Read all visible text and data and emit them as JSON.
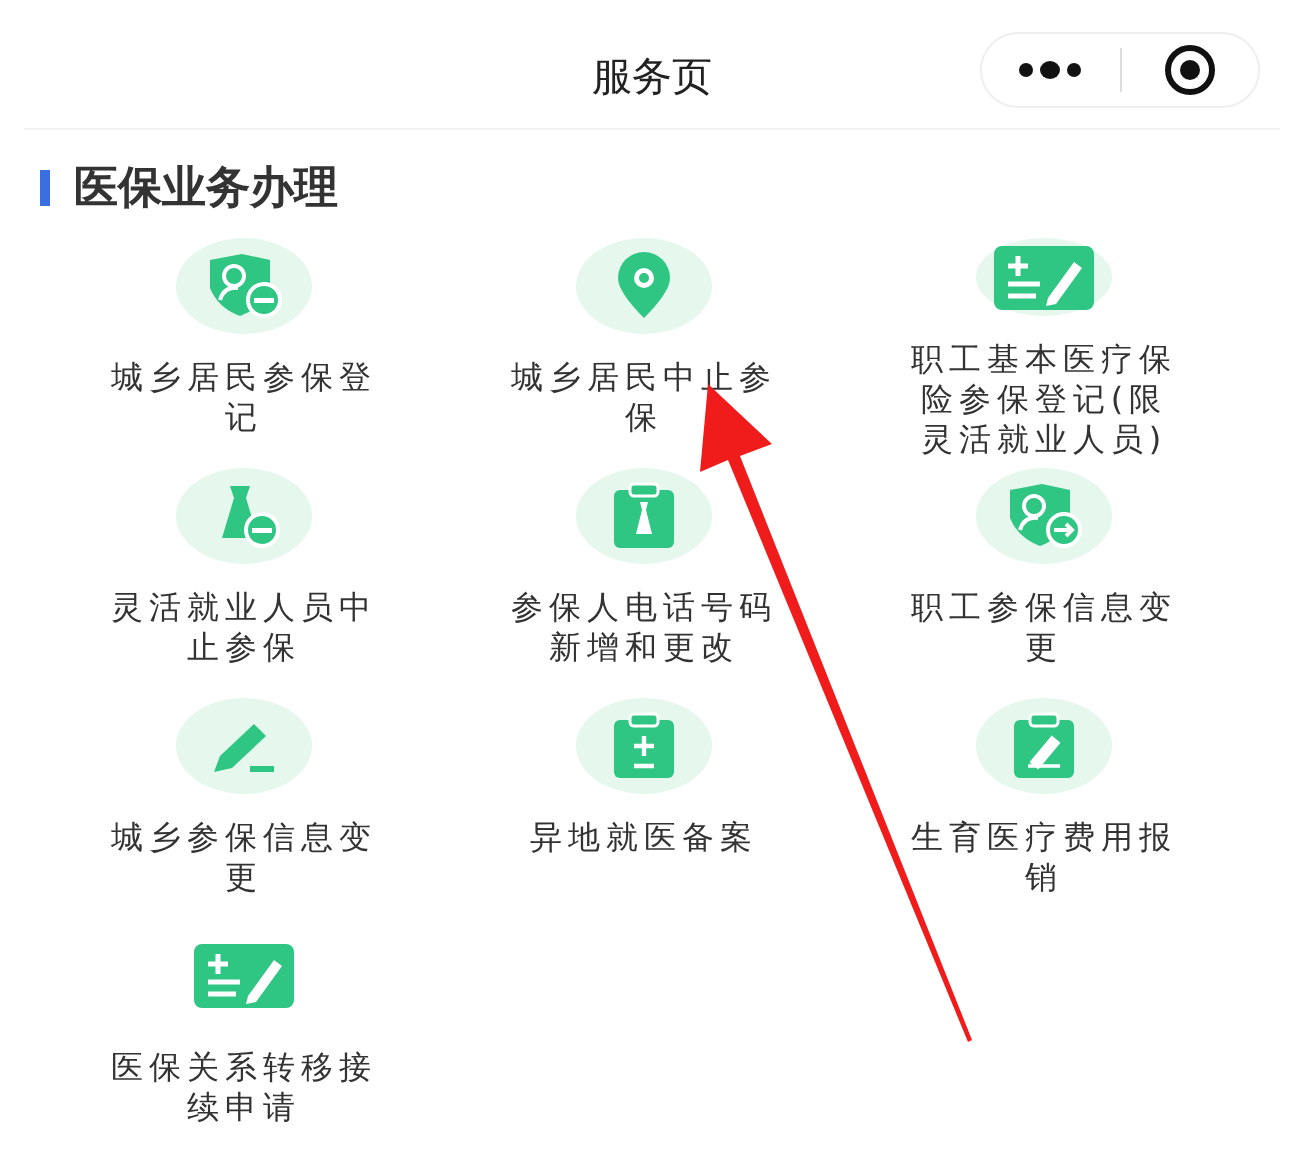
{
  "header": {
    "title": "服务页"
  },
  "section": {
    "title": "医保业务办理"
  },
  "services": [
    {
      "label": "城乡居民参保登记",
      "backdrop": true
    },
    {
      "label": "城乡居民中止参保",
      "backdrop": true
    },
    {
      "label": "职工基本医疗保险参保登记(限灵活就业人员)",
      "backdrop": true
    },
    {
      "label": "灵活就业人员中止参保",
      "backdrop": true
    },
    {
      "label": "参保人电话号码新增和更改",
      "backdrop": true
    },
    {
      "label": "职工参保信息变更",
      "backdrop": true
    },
    {
      "label": "城乡参保信息变更",
      "backdrop": true
    },
    {
      "label": "异地就医备案",
      "backdrop": true
    },
    {
      "label": "生育医疗费用报销",
      "backdrop": true
    },
    {
      "label": "医保关系转移接续申请",
      "backdrop": false
    }
  ]
}
